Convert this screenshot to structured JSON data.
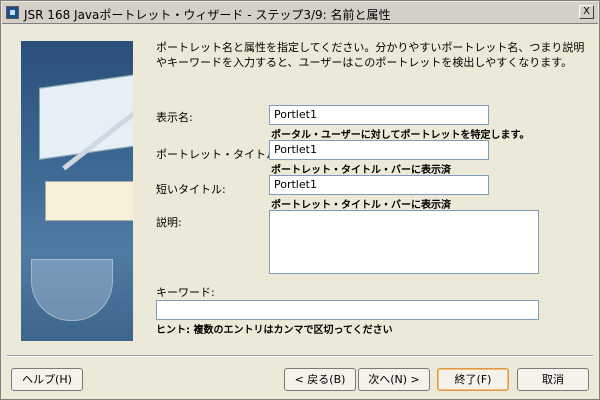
{
  "window": {
    "title": "JSR 168 Javaポートレット・ウィザード - ステップ3/9: 名前と属性",
    "close_label": "X"
  },
  "intro_text": "ポートレット名と属性を指定してください。分かりやすいポートレット名、つまり説明やキーワードを入力すると、ユーザーはこのポートレットを検出しやすくなります。",
  "form": {
    "display_name": {
      "label": "表示名:",
      "value": "Portlet1",
      "hint": "ポータル・ユーザーに対してポートレットを特定します。"
    },
    "portlet_title": {
      "label": "ポートレット・タイトル:",
      "value": "Portlet1",
      "hint": "ポートレット・タイトル・バーに表示済"
    },
    "short_title": {
      "label": "短いタイトル:",
      "value": "Portlet1",
      "hint": "ポートレット・タイトル・バーに表示済"
    },
    "description": {
      "label": "説明:",
      "value": ""
    },
    "keywords": {
      "label": "キーワード:",
      "value": "",
      "hint": "ヒント: 複数のエントリはカンマで区切ってください"
    }
  },
  "buttons": {
    "help": "ヘルプ(H)",
    "back": "< 戻る(B)",
    "next": "次へ(N) >",
    "finish": "終了(F)",
    "cancel": "取消"
  }
}
